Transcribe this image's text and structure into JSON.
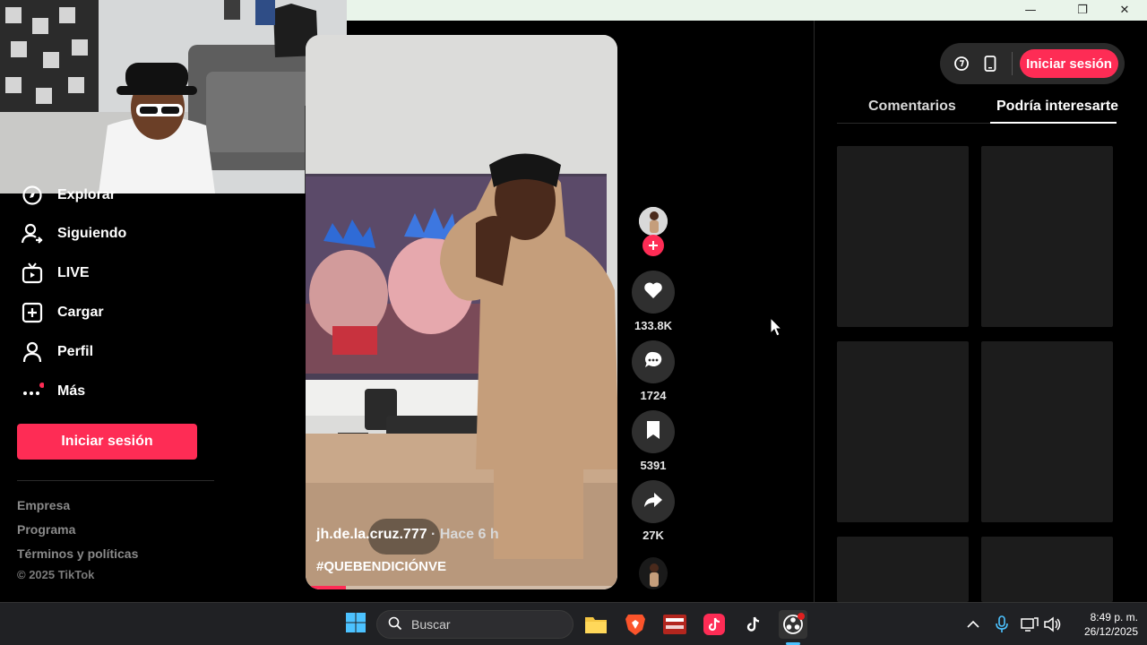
{
  "window": {
    "minimize": "—",
    "maximize": "❐",
    "close": "✕"
  },
  "sidebar": {
    "items": [
      {
        "label": "Explorar",
        "icon": "compass-icon"
      },
      {
        "label": "Siguiendo",
        "icon": "user-follow-icon"
      },
      {
        "label": "LIVE",
        "icon": "live-tv-icon"
      },
      {
        "label": "Cargar",
        "icon": "upload-plus-icon"
      },
      {
        "label": "Perfil",
        "icon": "person-icon"
      },
      {
        "label": "Más",
        "icon": "more-dots-icon"
      }
    ],
    "login_button": "Iniciar sesión",
    "footer": [
      "Empresa",
      "Programa",
      "Términos y políticas",
      "© 2025 TikTok"
    ]
  },
  "video": {
    "author": "jh.de.la.cruz.777",
    "time": " · Hace 6 h",
    "hashtag": "#QUEBENDICIÓNVE",
    "progress": 0.13
  },
  "actions": {
    "likes": "133.8K",
    "comments": "1724",
    "saves": "5391",
    "shares": "27K"
  },
  "right_panel": {
    "login_button": "Iniciar sesión",
    "tabs": [
      "Comentarios",
      "Podría interesarte"
    ],
    "active_tab": 1
  },
  "taskbar": {
    "search_placeholder": "Buscar",
    "time": "8:49 p. m.",
    "date": "26/12/2025",
    "accent": "#fe2c55"
  }
}
